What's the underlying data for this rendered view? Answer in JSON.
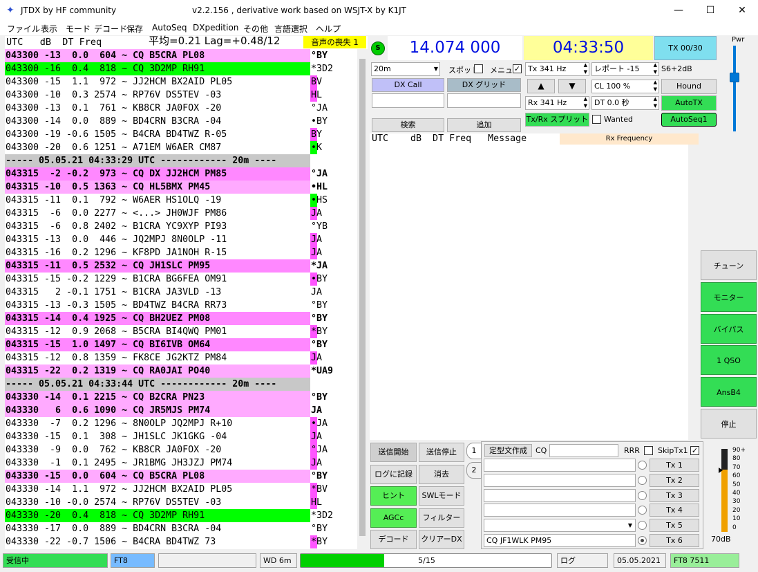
{
  "title": {
    "app": "JTDX  by HF community",
    "version": "v2.2.156 , derivative work based on WSJT-X by K1JT"
  },
  "window_controls": {
    "minimize": "—",
    "maximize": "☐",
    "close": "✕"
  },
  "menu": [
    "ファイル",
    "表示",
    "モード",
    "デコード",
    "保存",
    "AutoSeq",
    "DXpedition",
    "その他",
    "言語選択",
    "ヘルプ"
  ],
  "band_header": {
    "cols": "UTC   dB  DT Freq",
    "avg": "平均=0.21 Lag=+0.48/12",
    "audio": "音声の喪失 1"
  },
  "decodes": [
    {
      "t": "043300 -13  0.0  604 ~ CQ B5CRA PL08",
      "c": "°BY",
      "bg": "lpink",
      "bold": true,
      "mk": ""
    },
    {
      "t": "043300 -16  0.4  818 ~ CQ 3D2MP RH91",
      "c": "*3D2",
      "bg": "green",
      "bold": false,
      "mk": ""
    },
    {
      "t": "043300 -15  1.1  972 ~ JJ2HCM BX2AID PL05",
      "c": "BV",
      "bg": "",
      "bold": false,
      "mk": "pink"
    },
    {
      "t": "043300 -10  0.3 2574 ~ RP76V DS5TEV -03",
      "c": "HL",
      "bg": "",
      "bold": false,
      "mk": "pink"
    },
    {
      "t": "043300 -13  0.1  761 ~ KB8CR JA0FOX -20",
      "c": "°JA",
      "bg": "",
      "bold": false,
      "mk": ""
    },
    {
      "t": "043300 -14  0.0  889 ~ BD4CRN B3CRA -04",
      "c": "•BY",
      "bg": "",
      "bold": false,
      "mk": ""
    },
    {
      "t": "043300 -19 -0.6 1505 ~ B4CRA BD4TWZ R-05",
      "c": "BY",
      "bg": "",
      "bold": false,
      "mk": "pink"
    },
    {
      "t": "043300 -20  0.6 1251 ~ A71EM W6AER CM87",
      "c": "•K",
      "bg": "",
      "bold": false,
      "mk": "green"
    },
    {
      "t": "----- 05.05.21 04:33:29 UTC ------------ 20m ----",
      "c": "",
      "bg": "sep",
      "bold": true,
      "mk": ""
    },
    {
      "t": "043315  -2 -0.2  973 ~ CQ DX JJ2HCM PM85",
      "c": "°JA",
      "bg": "pink",
      "bold": true,
      "mk": ""
    },
    {
      "t": "043315 -10  0.5 1363 ~ CQ HL5BMX PM45",
      "c": "•HL",
      "bg": "lpink",
      "bold": true,
      "mk": ""
    },
    {
      "t": "043315 -11  0.1  792 ~ W6AER HS1OLQ -19",
      "c": "•HS",
      "bg": "",
      "bold": false,
      "mk": "green"
    },
    {
      "t": "043315  -6  0.0 2277 ~ <...> JH0WJF PM86",
      "c": "JA",
      "bg": "",
      "bold": false,
      "mk": "pink"
    },
    {
      "t": "043315  -6  0.8 2402 ~ B1CRA YC9XYP PI93",
      "c": "°YB",
      "bg": "",
      "bold": false,
      "mk": ""
    },
    {
      "t": "043315 -13  0.0  446 ~ JQ2MPJ 8N0OLP -11",
      "c": "JA",
      "bg": "",
      "bold": false,
      "mk": "pink"
    },
    {
      "t": "043315 -16  0.2 1296 ~ KF8PD JA1NOH R-15",
      "c": "JA",
      "bg": "",
      "bold": false,
      "mk": "pink"
    },
    {
      "t": "043315 -11  0.5 2532 ~ CQ JH1SLC PM95",
      "c": "*JA",
      "bg": "pink",
      "bold": true,
      "mk": ""
    },
    {
      "t": "043315 -15 -0.2 1229 ~ B1CRA BG6FEA OM91",
      "c": "•BY",
      "bg": "",
      "bold": false,
      "mk": "pink"
    },
    {
      "t": "043315   2 -0.1 1751 ~ B1CRA JA3VLD -13",
      "c": "JA",
      "bg": "",
      "bold": false,
      "mk": ""
    },
    {
      "t": "043315 -13 -0.3 1505 ~ BD4TWZ B4CRA RR73",
      "c": "°BY",
      "bg": "",
      "bold": false,
      "mk": ""
    },
    {
      "t": "043315 -14  0.4 1925 ~ CQ BH2UEZ PM08",
      "c": "°BY",
      "bg": "pink",
      "bold": true,
      "mk": ""
    },
    {
      "t": "043315 -12  0.9 2068 ~ B5CRA BI4QWQ PM01",
      "c": "*BY",
      "bg": "",
      "bold": false,
      "mk": "pink"
    },
    {
      "t": "043315 -15  1.0 1497 ~ CQ BI6IVB OM64",
      "c": "°BY",
      "bg": "pink",
      "bold": true,
      "mk": ""
    },
    {
      "t": "043315 -12  0.8 1359 ~ FK8CE JG2KTZ PM84",
      "c": "JA",
      "bg": "",
      "bold": false,
      "mk": "pink"
    },
    {
      "t": "043315 -22  0.2 1319 ~ CQ RA0JAI PO40",
      "c": "*UA9",
      "bg": "lpink",
      "bold": true,
      "mk": ""
    },
    {
      "t": "----- 05.05.21 04:33:44 UTC ------------ 20m ----",
      "c": "",
      "bg": "sep",
      "bold": true,
      "mk": ""
    },
    {
      "t": "043330 -14  0.1 2215 ~ CQ B2CRA PN23",
      "c": "°BY",
      "bg": "lpink",
      "bold": true,
      "mk": ""
    },
    {
      "t": "043330   6  0.6 1090 ~ CQ JR5MJS PM74",
      "c": "JA",
      "bg": "lpink",
      "bold": true,
      "mk": ""
    },
    {
      "t": "043330  -7  0.2 1296 ~ 8N0OLP JQ2MPJ R+10",
      "c": "•JA",
      "bg": "",
      "bold": false,
      "mk": "pink"
    },
    {
      "t": "043330 -15  0.1  308 ~ JH1SLC JK1GKG -04",
      "c": "JA",
      "bg": "",
      "bold": false,
      "mk": "pink"
    },
    {
      "t": "043330  -9  0.0  762 ~ KB8CR JA0FOX -20",
      "c": "°JA",
      "bg": "",
      "bold": false,
      "mk": "pink"
    },
    {
      "t": "043330  -1  0.1 2495 ~ JR1BMG JH3JZJ PM74",
      "c": "JA",
      "bg": "",
      "bold": false,
      "mk": "pink"
    },
    {
      "t": "043330 -15  0.0  604 ~ CQ B5CRA PL08",
      "c": "°BY",
      "bg": "lpink",
      "bold": true,
      "mk": ""
    },
    {
      "t": "043330 -14  1.1  972 ~ JJ2HCM BX2AID PL05",
      "c": "*BV",
      "bg": "",
      "bold": false,
      "mk": "pink"
    },
    {
      "t": "043330 -10 -0.0 2574 ~ RP76V DS5TEV -03",
      "c": "HL",
      "bg": "",
      "bold": false,
      "mk": "pink"
    },
    {
      "t": "043330 -20  0.4  818 ~ CQ 3D2MP RH91",
      "c": "*3D2",
      "bg": "green",
      "bold": false,
      "mk": ""
    },
    {
      "t": "043330 -17  0.0  889 ~ BD4CRN B3CRA -04",
      "c": "°BY",
      "bg": "",
      "bold": false,
      "mk": ""
    },
    {
      "t": "043330 -22 -0.7 1506 ~ B4CRA BD4TWZ 73",
      "c": "*BY",
      "bg": "",
      "bold": false,
      "mk": "pink"
    }
  ],
  "top": {
    "s_button": "S",
    "frequency": "14.074 000",
    "utc_time": "04:33:50",
    "tx_button": "TX 00/30",
    "pwr": "Pwr",
    "band": "20m",
    "spot": "スポット",
    "menu": "メニュー",
    "menu_checked": "✓",
    "tx_hz": "Tx  341  Hz",
    "report": "レポート -15",
    "signal": "S6+2dB",
    "dx_call_btn": "DX Call",
    "dx_grid_btn": "DX グリッド",
    "up": "▲",
    "down": "▼",
    "cl": "CL  100 %",
    "hound": "Hound",
    "rx_hz": "Rx  341  Hz",
    "dt": "DT 0.0 秒",
    "autotx": "AutoTX",
    "search": "検索",
    "add": "追加",
    "txrx_split": "Tx/Rx スプリット",
    "wanted": "Wanted",
    "autoseq": "AutoSeq1"
  },
  "rx": {
    "header": "UTC    dB  DT Freq   Message",
    "rxfreq": "Rx Frequency"
  },
  "right_buttons": [
    {
      "label": "チューン",
      "green": false
    },
    {
      "label": "モニター",
      "green": true
    },
    {
      "label": "バイパス",
      "green": true
    },
    {
      "label": "1 QSO",
      "green": true
    },
    {
      "label": "AnsB4",
      "green": true
    },
    {
      "label": "停止",
      "green": false
    }
  ],
  "bottom_left": [
    {
      "label": "送信開始",
      "style": "pressed"
    },
    {
      "label": "送信停止",
      "style": ""
    },
    {
      "label": "ログに記録",
      "style": ""
    },
    {
      "label": "消去",
      "style": ""
    },
    {
      "label": "ヒント",
      "style": "green"
    },
    {
      "label": "SWLモード",
      "style": ""
    },
    {
      "label": "AGCc",
      "style": "green"
    },
    {
      "label": "フィルター",
      "style": ""
    },
    {
      "label": "デコード",
      "style": ""
    },
    {
      "label": "クリアーDX",
      "style": ""
    }
  ],
  "txmsgs": {
    "tab1": "1",
    "tab2": "2",
    "gen_btn": "定型文作成",
    "cq_label": "CQ",
    "rrr": "RRR",
    "skiptx1": "SkipTx1",
    "skip_checked": "✓",
    "tx_buttons": [
      "Tx 1",
      "Tx 2",
      "Tx 3",
      "Tx 4",
      "Tx 5",
      "Tx 6"
    ],
    "msg6": "CQ JF1WLK PM95"
  },
  "meter": {
    "ticks": [
      "90+",
      "80",
      "70",
      "60",
      "50",
      "40",
      "30",
      "20",
      "10",
      "0"
    ],
    "value": "70dB"
  },
  "status": {
    "rx": "受信中",
    "mode": "FT8",
    "wd": "WD 6m",
    "progress_text": "5/15",
    "progress_fraction": 0.333,
    "log": "ログ",
    "date": "05.05.2021",
    "mode_freq": "FT8  7511"
  }
}
